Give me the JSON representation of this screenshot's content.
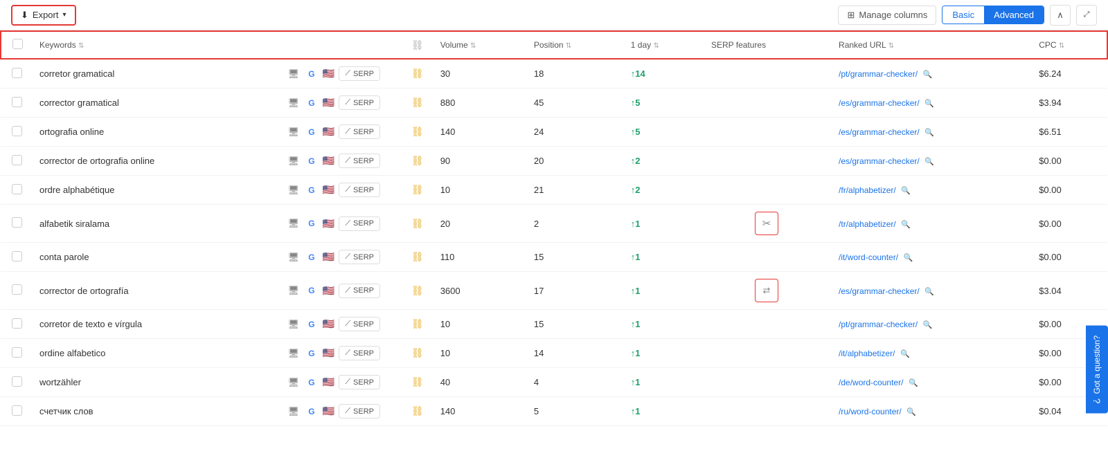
{
  "toolbar": {
    "export_label": "Export",
    "manage_columns_label": "Manage columns",
    "basic_label": "Basic",
    "advanced_label": "Advanced"
  },
  "table": {
    "headers": [
      {
        "id": "select",
        "label": ""
      },
      {
        "id": "keywords",
        "label": "Keywords",
        "sort": true
      },
      {
        "id": "tools",
        "label": ""
      },
      {
        "id": "link",
        "label": ""
      },
      {
        "id": "volume",
        "label": "Volume",
        "sort": true
      },
      {
        "id": "position",
        "label": "Position",
        "sort": true
      },
      {
        "id": "oneday",
        "label": "1 day",
        "sort": true
      },
      {
        "id": "serp",
        "label": "SERP features"
      },
      {
        "id": "ranked_url",
        "label": "Ranked URL",
        "sort": true
      },
      {
        "id": "cpc",
        "label": "CPC",
        "sort": true
      }
    ],
    "rows": [
      {
        "keyword": "corretor gramatical",
        "volume": "30",
        "position": "18",
        "change": "+14",
        "change_dir": "up",
        "serp_feature": "",
        "ranked_url": "/pt/grammar-checker/",
        "cpc": "$6.24"
      },
      {
        "keyword": "corrector gramatical",
        "volume": "880",
        "position": "45",
        "change": "+5",
        "change_dir": "up",
        "serp_feature": "",
        "ranked_url": "/es/grammar-checker/",
        "cpc": "$3.94"
      },
      {
        "keyword": "ortografia online",
        "volume": "140",
        "position": "24",
        "change": "+5",
        "change_dir": "up",
        "serp_feature": "",
        "ranked_url": "/es/grammar-checker/",
        "cpc": "$6.51"
      },
      {
        "keyword": "corrector de ortografia online",
        "volume": "90",
        "position": "20",
        "change": "+2",
        "change_dir": "up",
        "serp_feature": "",
        "ranked_url": "/es/grammar-checker/",
        "cpc": "$0.00"
      },
      {
        "keyword": "ordre alphabétique",
        "volume": "10",
        "position": "21",
        "change": "+2",
        "change_dir": "up",
        "serp_feature": "",
        "ranked_url": "/fr/alphabetizer/",
        "cpc": "$0.00"
      },
      {
        "keyword": "alfabetik siralama",
        "volume": "20",
        "position": "2",
        "change": "+1",
        "change_dir": "up",
        "serp_feature": "scissors",
        "ranked_url": "/tr/alphabetizer/",
        "cpc": "$0.00"
      },
      {
        "keyword": "conta parole",
        "volume": "110",
        "position": "15",
        "change": "+1",
        "change_dir": "up",
        "serp_feature": "",
        "ranked_url": "/it/word-counter/",
        "cpc": "$0.00"
      },
      {
        "keyword": "corrector de ortografía",
        "volume": "3600",
        "position": "17",
        "change": "+1",
        "change_dir": "up",
        "serp_feature": "arrows",
        "ranked_url": "/es/grammar-checker/",
        "cpc": "$3.04"
      },
      {
        "keyword": "corretor de texto e vírgula",
        "volume": "10",
        "position": "15",
        "change": "+1",
        "change_dir": "up",
        "serp_feature": "",
        "ranked_url": "/pt/grammar-checker/",
        "cpc": "$0.00"
      },
      {
        "keyword": "ordine alfabetico",
        "volume": "10",
        "position": "14",
        "change": "+1",
        "change_dir": "up",
        "serp_feature": "",
        "ranked_url": "/it/alphabetizer/",
        "cpc": "$0.00"
      },
      {
        "keyword": "wortzähler",
        "volume": "40",
        "position": "4",
        "change": "+1",
        "change_dir": "up",
        "serp_feature": "",
        "ranked_url": "/de/word-counter/",
        "cpc": "$0.00"
      },
      {
        "keyword": "счетчик слов",
        "volume": "140",
        "position": "5",
        "change": "+1",
        "change_dir": "up",
        "serp_feature": "",
        "ranked_url": "/ru/word-counter/",
        "cpc": "$0.04"
      }
    ]
  },
  "got_question": "Got a question?"
}
